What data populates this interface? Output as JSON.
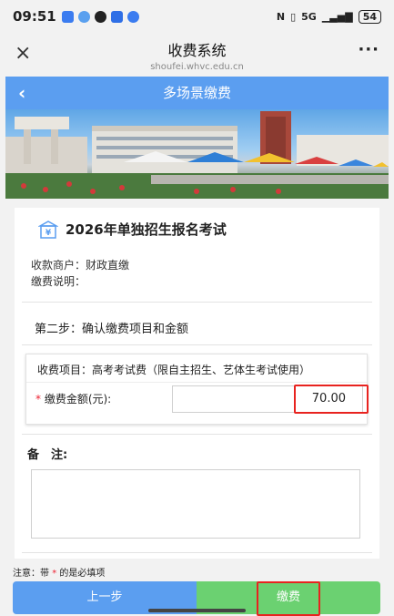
{
  "status": {
    "time": "09:51",
    "signal": "5G",
    "battery": "54",
    "colors": {
      "app1": "#3b7cf0",
      "app2": "#5aa0ef",
      "app3": "#222222",
      "app4": "#2f6fe6",
      "app5": "#3b7cf0"
    }
  },
  "titlebar": {
    "close_label": "×",
    "title": "收费系统",
    "domain": "shoufei.whvc.edu.cn",
    "more_label": "···"
  },
  "navbar": {
    "back_label": "‹",
    "title": "多场景缴费",
    "color": "#5b9ef0"
  },
  "card": {
    "exam_title": "2026年单独招生报名考试",
    "merchant": "收款商户：财政直缴",
    "description": "缴费说明：",
    "step_text": "第二步：确认缴费项目和金额",
    "item_label": "收费项目：高考考试费（限自主招生、艺体生考试使用）",
    "amount_star": "*",
    "amount_label": " 缴费金额(元):",
    "amount_value": "70.00",
    "remark_label": "备　注:",
    "remark_value": ""
  },
  "footer": {
    "note_prefix": "注意：带",
    "note_star": "*",
    "note_suffix": "的是必填项",
    "prev_label": "上一步",
    "pay_label": "缴费",
    "colors": {
      "prev": "#5b9ef0",
      "pay": "#6bd171",
      "highlight": "#e8231f"
    }
  }
}
